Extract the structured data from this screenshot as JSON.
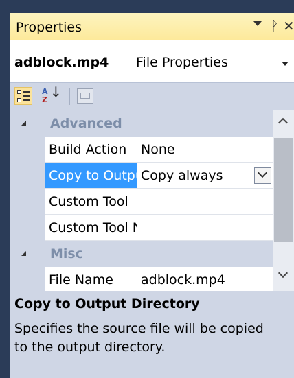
{
  "window": {
    "title": "Properties",
    "buttons": [
      "dropdown-icon",
      "pin-icon",
      "close-icon"
    ]
  },
  "object_selector": {
    "name": "adblock.mp4",
    "type": "File Properties"
  },
  "toolbar": {
    "buttons": [
      "categorized-icon",
      "alphabetical-icon",
      "property-pages-icon"
    ],
    "alpha_top": "A",
    "alpha_bottom": "Z",
    "alpha_arrow": "↓"
  },
  "grid": {
    "categories": [
      {
        "label": "Advanced",
        "properties": [
          {
            "name": "Build Action",
            "value": "None"
          },
          {
            "name": "Copy to Output Directory",
            "value": "Copy always",
            "selected": true
          },
          {
            "name": "Custom Tool",
            "value": ""
          },
          {
            "name": "Custom Tool Namespace",
            "value": ""
          }
        ]
      },
      {
        "label": "Misc",
        "properties": [
          {
            "name": "File Name",
            "value": "adblock.mp4"
          }
        ]
      }
    ]
  },
  "description": {
    "title": "Copy to Output Directory",
    "text": "Specifies the source file will be copied to the output directory."
  },
  "colors": {
    "titlebar": "#fde99a",
    "selection": "#3399ff",
    "panel": "#cfd6e5",
    "category_text": "#7d8ea9"
  }
}
